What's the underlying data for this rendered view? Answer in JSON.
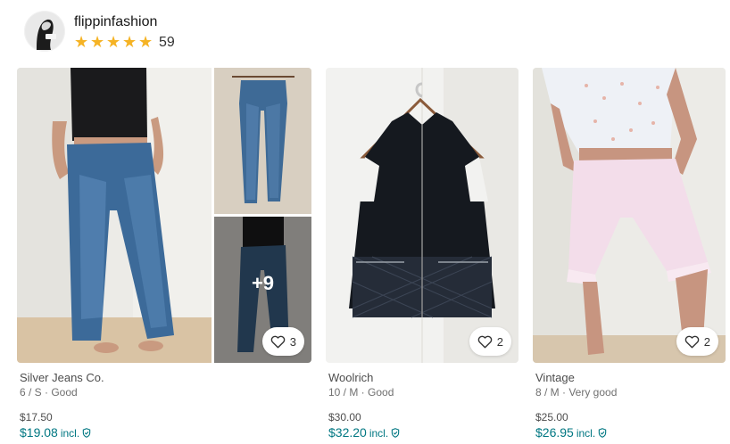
{
  "seller": {
    "username": "flippinfashion",
    "rating_value": 5,
    "rating_count": "59",
    "star_color": "#f5b325"
  },
  "items": [
    {
      "brand": "Silver Jeans Co.",
      "size_condition": "6 / S · Good",
      "price": "$17.50",
      "price_incl": "$19.08",
      "incl_label": "incl.",
      "favourites": "3",
      "extra_photos": "+9",
      "icons": [
        "heart-icon",
        "shield-icon"
      ]
    },
    {
      "brand": "Woolrich",
      "size_condition": "10 / M · Good",
      "price": "$30.00",
      "price_incl": "$32.20",
      "incl_label": "incl.",
      "favourites": "2",
      "icons": [
        "heart-icon",
        "shield-icon"
      ]
    },
    {
      "brand": "Vintage",
      "size_condition": "8 / M · Very good",
      "price": "$25.00",
      "price_incl": "$26.95",
      "incl_label": "incl.",
      "favourites": "2",
      "icons": [
        "heart-icon",
        "shield-icon"
      ]
    }
  ],
  "colors": {
    "accent": "#007782",
    "text_muted": "#707070"
  }
}
